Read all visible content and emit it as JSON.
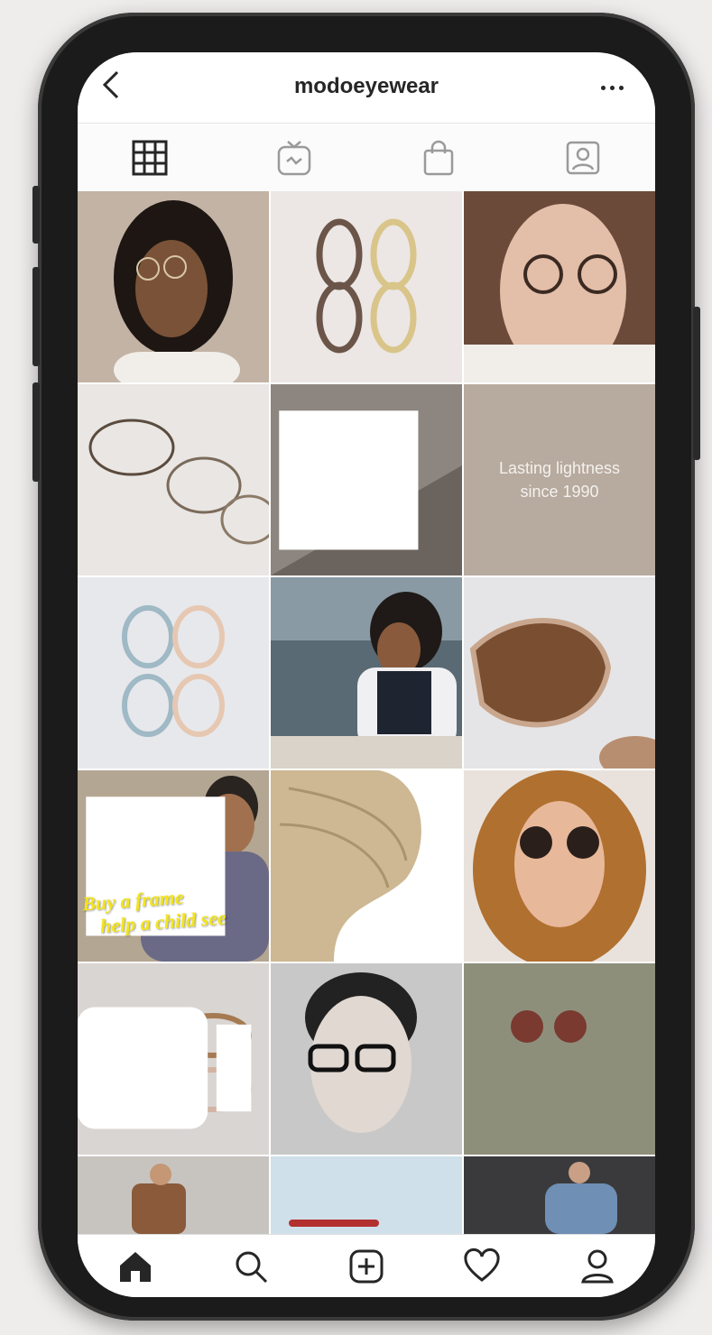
{
  "header": {
    "title": "modoeyewear",
    "back_icon": "chevron-left-icon",
    "more_icon": "ellipsis-icon"
  },
  "tabs": [
    {
      "name": "grid",
      "icon": "grid-icon",
      "active": true
    },
    {
      "name": "igtv",
      "icon": "igtv-icon",
      "active": false
    },
    {
      "name": "shop",
      "icon": "shopping-bag-icon",
      "active": false
    },
    {
      "name": "tagged",
      "icon": "tagged-portrait-icon",
      "active": false
    }
  ],
  "posts": {
    "text_tile": {
      "line1": "Lasting lightness",
      "line2": "since 1990"
    },
    "promo_tile": {
      "line1": "Buy a frame",
      "line2": "help a child see"
    }
  },
  "bottom_nav": [
    {
      "name": "home",
      "icon": "home-icon"
    },
    {
      "name": "search",
      "icon": "search-icon"
    },
    {
      "name": "new-post",
      "icon": "add-post-icon"
    },
    {
      "name": "activity",
      "icon": "heart-icon"
    },
    {
      "name": "profile",
      "icon": "profile-icon"
    }
  ],
  "colors": {
    "text": "#262626",
    "promo_yellow": "#f3e51b",
    "background": "#ffffff"
  }
}
